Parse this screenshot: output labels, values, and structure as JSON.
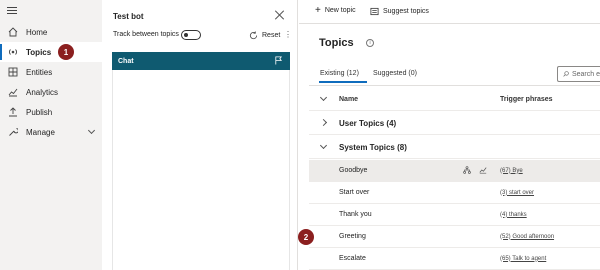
{
  "nav": {
    "items": [
      {
        "label": "Home",
        "icon": "home-icon"
      },
      {
        "label": "Topics",
        "icon": "topics-icon",
        "active": true
      },
      {
        "label": "Entities",
        "icon": "entities-icon"
      },
      {
        "label": "Analytics",
        "icon": "analytics-icon"
      },
      {
        "label": "Publish",
        "icon": "publish-icon"
      },
      {
        "label": "Manage",
        "icon": "manage-icon"
      }
    ]
  },
  "callouts": {
    "one": "1",
    "two": "2"
  },
  "test_bot": {
    "title": "Test bot",
    "track_label": "Track between topics",
    "reset_label": "Reset",
    "chat_label": "Chat"
  },
  "toolbar": {
    "new_topic": "New topic",
    "suggest_topics": "Suggest topics"
  },
  "topics": {
    "title": "Topics",
    "tabs": {
      "existing": "Existing (12)",
      "suggested": "Suggested (0)"
    },
    "search_placeholder": "Search e",
    "columns": {
      "name": "Name",
      "trigger": "Trigger phrases"
    },
    "groups": {
      "user": "User Topics (4)",
      "system": "System Topics (8)"
    },
    "rows": [
      {
        "name": "Goodbye",
        "trigger": "(67) Bye"
      },
      {
        "name": "Start over",
        "trigger": "(3) start over"
      },
      {
        "name": "Thank you",
        "trigger": "(4) thanks"
      },
      {
        "name": "Greeting",
        "trigger": "(52) Good afternoon"
      },
      {
        "name": "Escalate",
        "trigger": "(65) Talk to agent"
      }
    ]
  },
  "colors": {
    "accent": "#0f6cbd",
    "chat_header": "#0f5a70",
    "callout": "#8b1f1f"
  }
}
